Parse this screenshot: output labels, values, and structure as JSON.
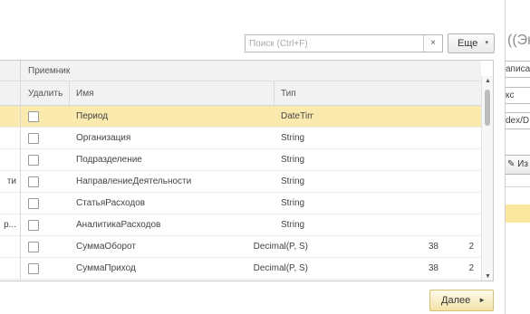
{
  "toolbar": {
    "search_placeholder": "Поиск (Ctrl+F)",
    "search_clear": "×",
    "more_label": "Еще",
    "more_arrow": "▾"
  },
  "table": {
    "group_label": "Приемник",
    "columns": [
      "Удалить",
      "Имя",
      "Тип"
    ],
    "rows": [
      {
        "left": "",
        "name": "Период",
        "type": "DateTime",
        "len": "",
        "prec": "",
        "selected": true
      },
      {
        "left": "",
        "name": "Организация",
        "type": "String",
        "len": "",
        "prec": ""
      },
      {
        "left": "",
        "name": "Подразделение",
        "type": "String",
        "len": "",
        "prec": ""
      },
      {
        "left": "ти",
        "name": "НаправлениеДеятельности",
        "type": "String",
        "len": "",
        "prec": ""
      },
      {
        "left": "",
        "name": "СтатьяРасходов",
        "type": "String",
        "len": "",
        "prec": ""
      },
      {
        "left": "р...",
        "name": "АналитикаРасходов",
        "type": "String",
        "len": "",
        "prec": ""
      },
      {
        "left": "",
        "name": "СуммаОборот",
        "type": "Decimal(P, S)",
        "len": "38",
        "prec": "2"
      },
      {
        "left": "",
        "name": "СуммаПриход",
        "type": "Decimal(P, S)",
        "len": "38",
        "prec": "2"
      }
    ],
    "scroll_up": "▲",
    "scroll_down": "▼"
  },
  "footer": {
    "next_label": "Далее",
    "next_arrow": "►"
  },
  "side_panel": {
    "title": "((Эк",
    "field1": "аписа",
    "field2": "кс",
    "field3": "dex/D",
    "button_label": "Из"
  },
  "colors": {
    "selected_row": "#fbeaae",
    "next_button": "#f3e3a7"
  }
}
